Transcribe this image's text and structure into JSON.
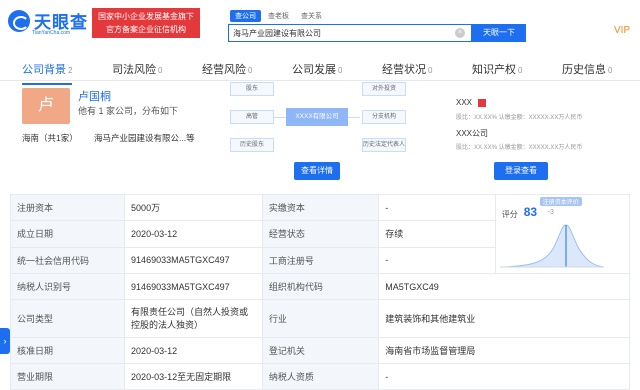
{
  "header": {
    "logo_text": "天眼查",
    "logo_sub": "TianYanCha.com",
    "promo_line1": "国家中小企业发展基金旗下",
    "promo_line2": "官方备案企业征信机构",
    "search_tabs": [
      "查公司",
      "查老板",
      "查关系"
    ],
    "search_value": "海马产业园建设有限公司",
    "search_clear": "×",
    "search_button": "天眼一下",
    "vip": "VIP"
  },
  "nav": [
    {
      "label": "公司背景",
      "count": "2"
    },
    {
      "label": "司法风险",
      "count": "0"
    },
    {
      "label": "经营风险",
      "count": "0"
    },
    {
      "label": "公司发展",
      "count": "0"
    },
    {
      "label": "经营状况",
      "count": "0"
    },
    {
      "label": "知识产权",
      "count": "0"
    },
    {
      "label": "历史信息",
      "count": "0"
    }
  ],
  "person": {
    "avatar_char": "卢",
    "name": "卢国桐",
    "desc": "他有 1 家公司，分布如下",
    "region": "海南（共1家）",
    "company": "海马产业园建设有限公...等"
  },
  "diagram": {
    "center": "XXXX有限公司",
    "left_top": "股东",
    "left_mid": "高管",
    "left_bot": "历史股东",
    "right_top": "对外投资",
    "right_mid": "分支机构",
    "right_bot": "历史法定代表人",
    "button": "查看详情"
  },
  "relation": {
    "row1": "XXX",
    "row1_sub": "股比：XX.XX%  认缴金额：XXXXX.XX万人民币",
    "row2": "XXX公司",
    "row2_sub": "股比：XX.XX%  认缴金额：XXXXX.XX万人民币",
    "button": "登录查看"
  },
  "info": {
    "reg_capital_k": "注册资本",
    "reg_capital_v": "5000万",
    "paid_capital_k": "实缴资本",
    "paid_capital_v": "-",
    "est_date_k": "成立日期",
    "est_date_v": "2020-03-12",
    "status_k": "经营状态",
    "status_v": "存续",
    "credit_code_k": "统一社会信用代码",
    "credit_code_v": "91469033MA5TGXC497",
    "biz_reg_k": "工商注册号",
    "biz_reg_v": "-",
    "taxpayer_k": "纳税人识别号",
    "taxpayer_v": "91469033MA5TGXC497",
    "org_code_k": "组织机构代码",
    "org_code_v": "MA5TGXC49",
    "type_k": "公司类型",
    "type_v": "有限责任公司（自然人投资或控股的法人独资）",
    "industry_k": "行业",
    "industry_v": "建筑装饰和其他建筑业",
    "approve_k": "核准日期",
    "approve_v": "2020-03-12",
    "reg_auth_k": "登记机关",
    "reg_auth_v": "海南省市场监督管理局",
    "term_k": "营业期限",
    "term_v": "2020-03-12至无固定期限",
    "qual_k": "纳税人资质",
    "qual_v": "-"
  },
  "score": {
    "badge": "注册资本评价",
    "label": "评分",
    "value": "83",
    "delta": "-3"
  },
  "side_arrow": "›"
}
